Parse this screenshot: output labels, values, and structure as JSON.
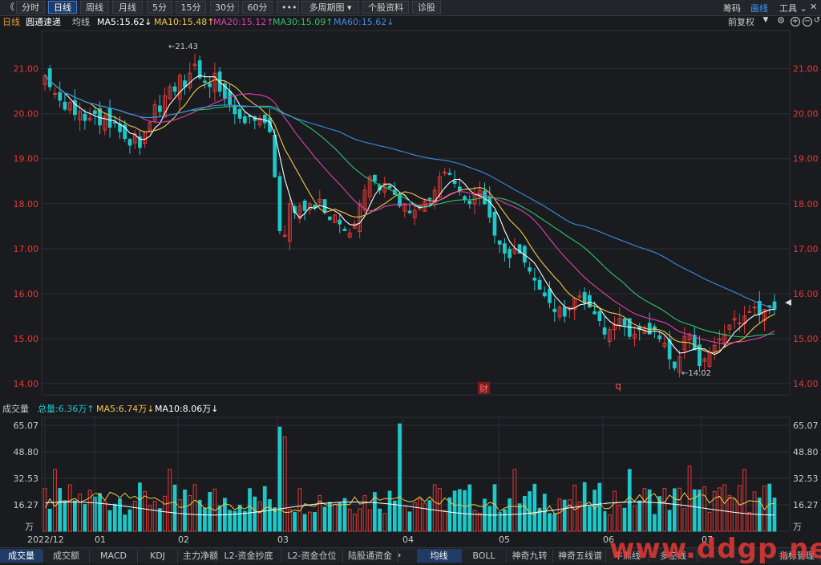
{
  "topbar": {
    "back_icon": "double-chevron-left-icon",
    "tabs": [
      "分时",
      "日线",
      "周线",
      "月线",
      "5分",
      "15分",
      "30分",
      "60分",
      "•••",
      "多周期图",
      "个股资料",
      "诊股"
    ],
    "active_tab": "日线",
    "right_items": [
      "筹码",
      "画线",
      "工具"
    ],
    "active_right": "画线"
  },
  "legend": {
    "period": "日线",
    "name": "圆通速递",
    "avg_label": "均线",
    "ma5": "MA5:15.62↓",
    "ma10": "MA10:15.48↑",
    "ma20": "MA20:15.12↑",
    "ma30": "MA30:15.09↑",
    "ma60": "MA60:15.62↓",
    "adjust": "前复权"
  },
  "volume_legend": {
    "title": "成交量",
    "total": "总量:6.36万↑",
    "ma5": "MA5:6.74万↓",
    "ma10": "MA10:8.06万↓"
  },
  "bottombar": {
    "left_tabs": [
      "成交量",
      "成交额",
      "MACD",
      "KDJ",
      "主力净额",
      "L2-资金抄底",
      "L2-资金仓位",
      "陆股通资金"
    ],
    "active_left": "成交量",
    "right_tabs": [
      "均线",
      "BOLL",
      "神奇九转",
      "神奇五线谱",
      "牛熊线",
      "多空线",
      "指标管理"
    ],
    "active_right": "均线"
  },
  "watermark": "www.ddgp.net",
  "colors": {
    "up": "#e53935",
    "down": "#1fc8c8",
    "ma5": "#ffffff",
    "ma10": "#f3c84a",
    "ma20": "#e040b0",
    "ma30": "#2fc36a",
    "ma60": "#3a8de0",
    "background": "#1a1b1f",
    "grid": "#2d2f35"
  },
  "chart_data": [
    {
      "type": "candlestick",
      "title": "圆通速递 日线",
      "y_ticks": [
        "21.00",
        "20.00",
        "19.00",
        "18.00",
        "17.00",
        "16.00",
        "15.00",
        "14.00"
      ],
      "ylim": [
        13.75,
        21.85
      ],
      "x_ticks": [
        "2022/12",
        "01",
        "02",
        "03",
        "04",
        "05",
        "06",
        "07"
      ],
      "high_marker": "21.43",
      "low_marker": "14.02",
      "markers": [
        "财",
        "q"
      ],
      "close": [
        20.85,
        20.6,
        20.45,
        20.3,
        20.1,
        20.25,
        19.98,
        20.05,
        19.85,
        19.9,
        20.0,
        19.75,
        19.95,
        19.7,
        19.8,
        19.6,
        19.45,
        19.3,
        19.55,
        19.25,
        19.6,
        19.8,
        20.2,
        20.05,
        20.4,
        20.6,
        20.5,
        20.85,
        20.6,
        20.9,
        21.1,
        20.8,
        20.7,
        20.6,
        20.9,
        20.5,
        20.35,
        20.2,
        20.0,
        19.9,
        19.8,
        19.95,
        19.85,
        19.9,
        19.8,
        19.6,
        18.6,
        17.4,
        17.3,
        18.0,
        17.8,
        17.95,
        17.85,
        18.0,
        17.9,
        18.1,
        17.8,
        17.65,
        17.75,
        17.55,
        17.4,
        17.35,
        17.55,
        18.0,
        18.3,
        18.6,
        18.5,
        18.3,
        18.45,
        18.35,
        18.2,
        17.95,
        18.0,
        17.8,
        17.85,
        17.95,
        18.05,
        18.1,
        18.3,
        18.6,
        18.7,
        18.65,
        18.45,
        18.3,
        18.1,
        18.0,
        18.2,
        18.3,
        18.0,
        17.7,
        17.3,
        17.1,
        16.9,
        16.8,
        17.0,
        16.9,
        16.7,
        16.5,
        16.3,
        16.1,
        15.95,
        15.8,
        15.6,
        15.7,
        15.5,
        15.7,
        15.9,
        15.95,
        15.8,
        15.7,
        15.55,
        15.4,
        15.1,
        15.2,
        15.3,
        15.45,
        15.3,
        15.05,
        15.1,
        15.2,
        15.25,
        15.1,
        15.2,
        15.0,
        14.9,
        14.55,
        14.35,
        14.6,
        15.05,
        15.1,
        14.75,
        14.4,
        14.55,
        14.7,
        14.85,
        15.0,
        15.1,
        15.3,
        15.45,
        15.35,
        15.5,
        15.6,
        15.7,
        15.55,
        15.65,
        15.7,
        15.65
      ],
      "ma_series": [
        "MA5",
        "MA10",
        "MA20",
        "MA30",
        "MA60"
      ]
    },
    {
      "type": "bar",
      "title": "成交量",
      "unit": "万",
      "y_ticks": [
        "65.07",
        "48.80",
        "32.53",
        "16.27"
      ],
      "ylim": [
        0,
        70
      ]
    }
  ]
}
